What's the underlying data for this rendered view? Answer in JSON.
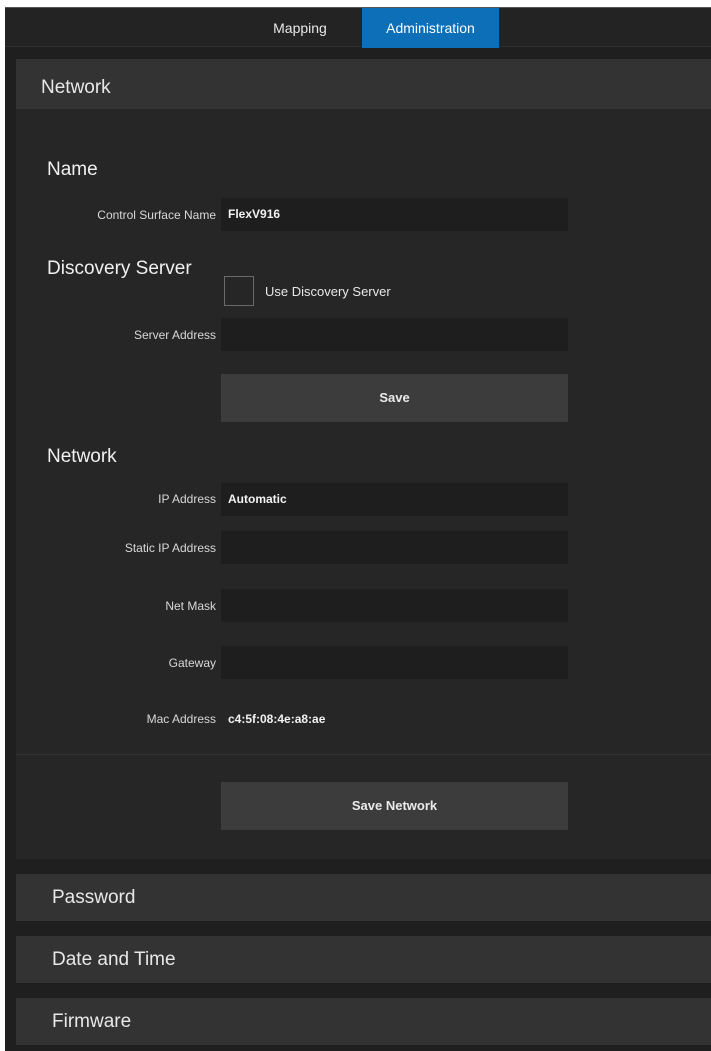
{
  "tabs": {
    "mapping": "Mapping",
    "administration": "Administration"
  },
  "network_panel": {
    "title": "Network",
    "name_section": {
      "title": "Name",
      "control_surface_name_label": "Control Surface Name",
      "control_surface_name_value": "FlexV916"
    },
    "discovery_section": {
      "title": "Discovery Server",
      "use_discovery_label": "Use Discovery Server",
      "use_discovery_checked": false,
      "server_address_label": "Server Address",
      "server_address_value": "",
      "save_label": "Save"
    },
    "network_section": {
      "title": "Network",
      "ip_address_label": "IP Address",
      "ip_address_value": "Automatic",
      "static_ip_label": "Static IP Address",
      "static_ip_value": "",
      "net_mask_label": "Net Mask",
      "net_mask_value": "",
      "gateway_label": "Gateway",
      "gateway_value": "",
      "mac_address_label": "Mac Address",
      "mac_address_value": "c4:5f:08:4e:a8:ae",
      "save_network_label": "Save Network"
    }
  },
  "collapsed_panels": {
    "password": "Password",
    "date_and_time": "Date and Time",
    "firmware": "Firmware"
  },
  "colors": {
    "accent": "#0d6fb8",
    "background": "#1f1f1f",
    "panel_header": "#333333",
    "field": "#1e1e1e",
    "button": "#3c3c3c"
  }
}
